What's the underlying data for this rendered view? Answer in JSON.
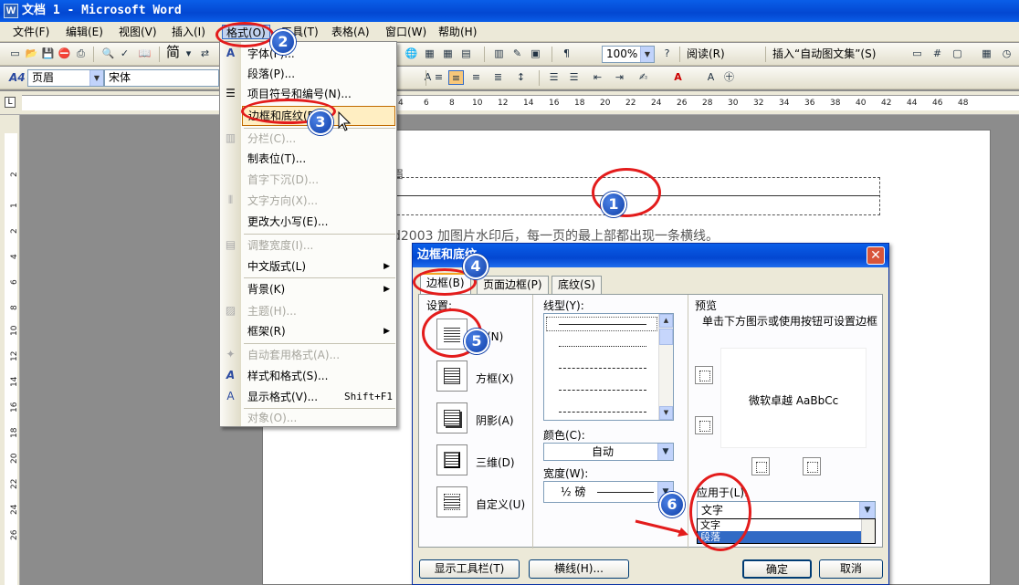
{
  "window": {
    "title": "文档 1 - Microsoft Word"
  },
  "menubar": [
    "文件(F)",
    "编辑(E)",
    "视图(V)",
    "插入(I)",
    "格式(O)",
    "工具(T)",
    "表格(A)",
    "窗口(W)",
    "帮助(H)"
  ],
  "toolbar1": {
    "zoom": "100%",
    "read_label": "阅读(R)",
    "insert_autotext": "插入“自动图文集”(S)",
    "simplified": "简"
  },
  "toolbar2": {
    "style": "页眉",
    "font": "宋体",
    "style_icon": "A4"
  },
  "ruler": {
    "h_ticks": [
      "4",
      "6",
      "8",
      "10",
      "12",
      "14",
      "16",
      "18",
      "20",
      "22",
      "24",
      "26",
      "28",
      "30",
      "32",
      "34",
      "36",
      "38",
      "40",
      "42",
      "44",
      "46",
      "48"
    ],
    "v_ticks": [
      "2",
      "1",
      "2",
      "4",
      "6",
      "8",
      "10",
      "12",
      "14",
      "16",
      "18",
      "20",
      "22",
      "24",
      "26"
    ]
  },
  "document": {
    "body_text": "d2003 加图片水印后，每一页的最上部都出现一条横线。",
    "header_label": "眉"
  },
  "format_menu": {
    "items": [
      {
        "label": "字体(F)...",
        "icon": "font-icon"
      },
      {
        "label": "段落(P)..."
      },
      {
        "label": "项目符号和编号(N)...",
        "icon": "bullets-icon"
      },
      {
        "label": "边框和底纹(B)..."
      },
      {
        "label": "分栏(C)...",
        "icon": "columns-icon",
        "disabled": true
      },
      {
        "label": "制表位(T)..."
      },
      {
        "label": "首字下沉(D)...",
        "disabled": true
      },
      {
        "label": "文字方向(X)...",
        "icon": "text-direction-icon",
        "disabled": true
      },
      {
        "label": "更改大小写(E)..."
      },
      {
        "label": "调整宽度(I)...",
        "icon": "fit-width-icon",
        "disabled": true
      },
      {
        "label": "中文版式(L)",
        "submenu": true
      },
      {
        "label": "背景(K)",
        "submenu": true
      },
      {
        "label": "主题(H)...",
        "icon": "theme-icon",
        "disabled": true
      },
      {
        "label": "框架(R)",
        "submenu": true
      },
      {
        "label": "自动套用格式(A)...",
        "icon": "autoformat-icon",
        "disabled": true
      },
      {
        "label": "样式和格式(S)...",
        "icon": "styles-icon"
      },
      {
        "label": "显示格式(V)...",
        "shortcut": "Shift+F1",
        "icon": "reveal-format-icon"
      },
      {
        "label": "对象(O)...",
        "disabled": true
      }
    ]
  },
  "dialog": {
    "title": "边框和底纹",
    "tabs": [
      "边框(B)",
      "页面边框(P)",
      "底纹(S)"
    ],
    "settings_label": "设置:",
    "settings": [
      "无(N)",
      "方框(X)",
      "阴影(A)",
      "三维(D)",
      "自定义(U)"
    ],
    "line_style_label": "线型(Y):",
    "color_label": "颜色(C):",
    "color_value": "自动",
    "width_label": "宽度(W):",
    "width_value": "½ 磅",
    "preview_label": "预览",
    "preview_hint": "单击下方图示或使用按钮可设置边框",
    "preview_sample": "微软卓越 AaBbCc",
    "apply_label": "应用于(L):",
    "apply_value": "文字",
    "apply_options": [
      "文字",
      "段落"
    ],
    "buttons": {
      "toolbar": "显示工具栏(T)",
      "hline": "横线(H)...",
      "ok": "确定",
      "cancel": "取消"
    }
  },
  "annotations": [
    "1",
    "2",
    "3",
    "4",
    "5",
    "6"
  ],
  "colors": {
    "accent": "#0a5ee8",
    "highlight": "#ffeec2",
    "annotation_red": "#e31c1c"
  }
}
